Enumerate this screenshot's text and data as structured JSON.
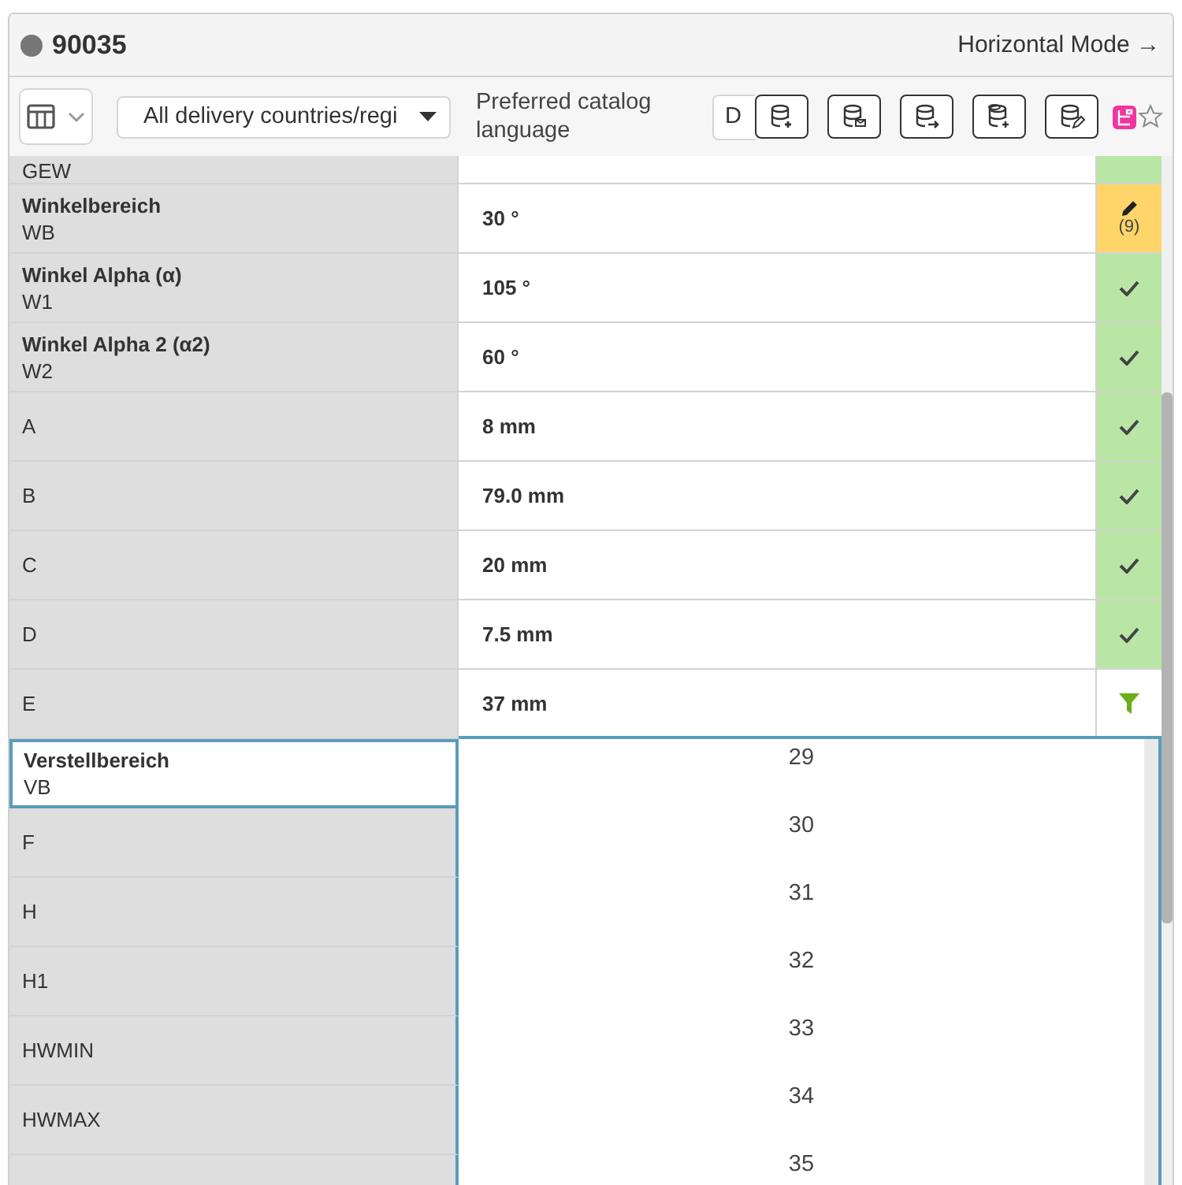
{
  "header": {
    "title": "90035",
    "mode_link": "Horizontal Mode →"
  },
  "toolbar": {
    "country_filter": "All delivery countries/regi",
    "language_label": "Preferred catalog language",
    "language_value": "D",
    "actions": [
      {
        "kind": "add"
      },
      {
        "kind": "mail"
      },
      {
        "kind": "export"
      },
      {
        "kind": "copy"
      },
      {
        "kind": "edit"
      }
    ]
  },
  "properties": [
    {
      "code": "GEW",
      "status": {
        "kind": "ok"
      }
    },
    {
      "label": "Winkelbereich",
      "code": "WB",
      "value": "30 °",
      "status": {
        "kind": "edit",
        "count": "(9)"
      }
    },
    {
      "label": "Winkel Alpha (α)",
      "code": "W1",
      "value": "105 °",
      "status": {
        "kind": "ok"
      }
    },
    {
      "label": "Winkel Alpha 2 (α2)",
      "code": "W2",
      "value": "60 °",
      "status": {
        "kind": "ok"
      }
    },
    {
      "code": "A",
      "value": "8 mm",
      "status": {
        "kind": "ok"
      }
    },
    {
      "code": "B",
      "value": "79.0 mm",
      "status": {
        "kind": "ok"
      }
    },
    {
      "code": "C",
      "value": "20 mm",
      "status": {
        "kind": "ok"
      }
    },
    {
      "code": "D",
      "value": "7.5 mm",
      "status": {
        "kind": "ok"
      }
    },
    {
      "code": "E",
      "value": "37 mm",
      "status": {
        "kind": "filter"
      }
    }
  ],
  "open_properties": [
    {
      "label": "Verstellbereich",
      "code": "VB",
      "selected": true
    },
    {
      "code": "F",
      "selected": false
    },
    {
      "code": "H",
      "selected": false
    },
    {
      "code": "H1",
      "selected": false
    },
    {
      "code": "HWMIN",
      "selected": false
    },
    {
      "code": "HWMAX",
      "selected": false
    }
  ],
  "dropdown_options": [
    "29",
    "30",
    "31",
    "32",
    "33",
    "34",
    "35"
  ]
}
